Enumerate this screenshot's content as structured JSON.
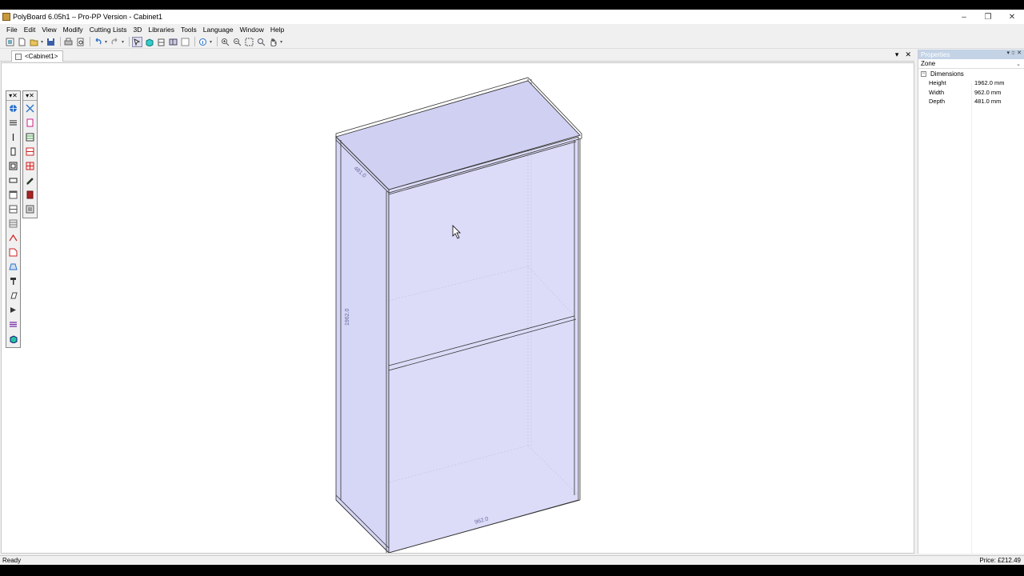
{
  "window": {
    "title": "PolyBoard 6.05h1 – Pro-PP Version - Cabinet1",
    "minimize": "–",
    "restore": "❐",
    "close": "✕"
  },
  "menu": [
    "File",
    "Edit",
    "View",
    "Modify",
    "Cutting Lists",
    "3D",
    "Libraries",
    "Tools",
    "Language",
    "Window",
    "Help"
  ],
  "document_tab": {
    "label": "<Cabinet1>",
    "dropdown": "▾",
    "close": "✕"
  },
  "palettes": {
    "left_header": "▾✕",
    "right_header": "▾✕"
  },
  "canvas": {
    "depth_label": "481.0",
    "height_label": "1962.0",
    "width_label": "962.0"
  },
  "properties": {
    "title": "Properties",
    "title_controls": "▾ ⯐ ✕",
    "zone_selector": "Zone",
    "group": "Dimensions",
    "rows": [
      {
        "name": "Height",
        "value": "1962.0 mm"
      },
      {
        "name": "Width",
        "value": "962.0 mm"
      },
      {
        "name": "Depth",
        "value": "481.0 mm"
      }
    ]
  },
  "status": {
    "left": "Ready",
    "right": "Price: £212.49"
  },
  "colors": {
    "panel_fill": "#d8d8f8",
    "accent_blue": "#2a70c8",
    "accent_red": "#cc2222"
  }
}
